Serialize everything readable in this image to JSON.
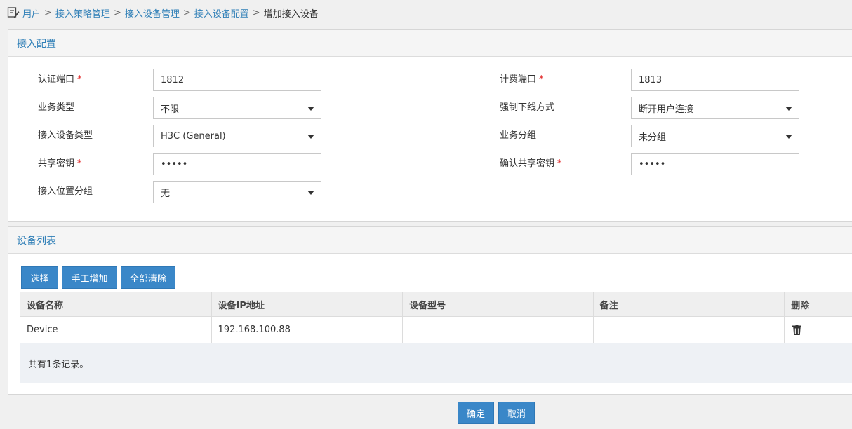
{
  "breadcrumb": {
    "items": [
      "用户",
      "接入策略管理",
      "接入设备管理",
      "接入设备配置"
    ],
    "separator": ">",
    "current": "增加接入设备"
  },
  "config": {
    "title": "接入配置",
    "auth_port_label": "认证端口",
    "auth_port_value": "1812",
    "acct_port_label": "计费端口",
    "acct_port_value": "1813",
    "service_type_label": "业务类型",
    "service_type_value": "不限",
    "force_offline_label": "强制下线方式",
    "force_offline_value": "断开用户连接",
    "device_type_label": "接入设备类型",
    "device_type_value": "H3C (General)",
    "service_group_label": "业务分组",
    "service_group_value": "未分组",
    "shared_key_label": "共享密钥",
    "shared_key_value": "•••••",
    "confirm_key_label": "确认共享密钥",
    "confirm_key_value": "•••••",
    "location_group_label": "接入位置分组",
    "location_group_value": "无",
    "required_mark": "*"
  },
  "device_list": {
    "title": "设备列表",
    "buttons": {
      "select": "选择",
      "manual_add": "手工增加",
      "clear_all": "全部清除"
    },
    "columns": [
      "设备名称",
      "设备IP地址",
      "设备型号",
      "备注",
      "删除"
    ],
    "rows": [
      {
        "name": "Device",
        "ip": "192.168.100.88",
        "model": "",
        "note": ""
      }
    ],
    "footer": "共有1条记录。"
  },
  "actions": {
    "ok": "确定",
    "cancel": "取消"
  },
  "colors": {
    "accent": "#3a87c8",
    "link": "#2f7fb7",
    "required": "#e02020"
  }
}
